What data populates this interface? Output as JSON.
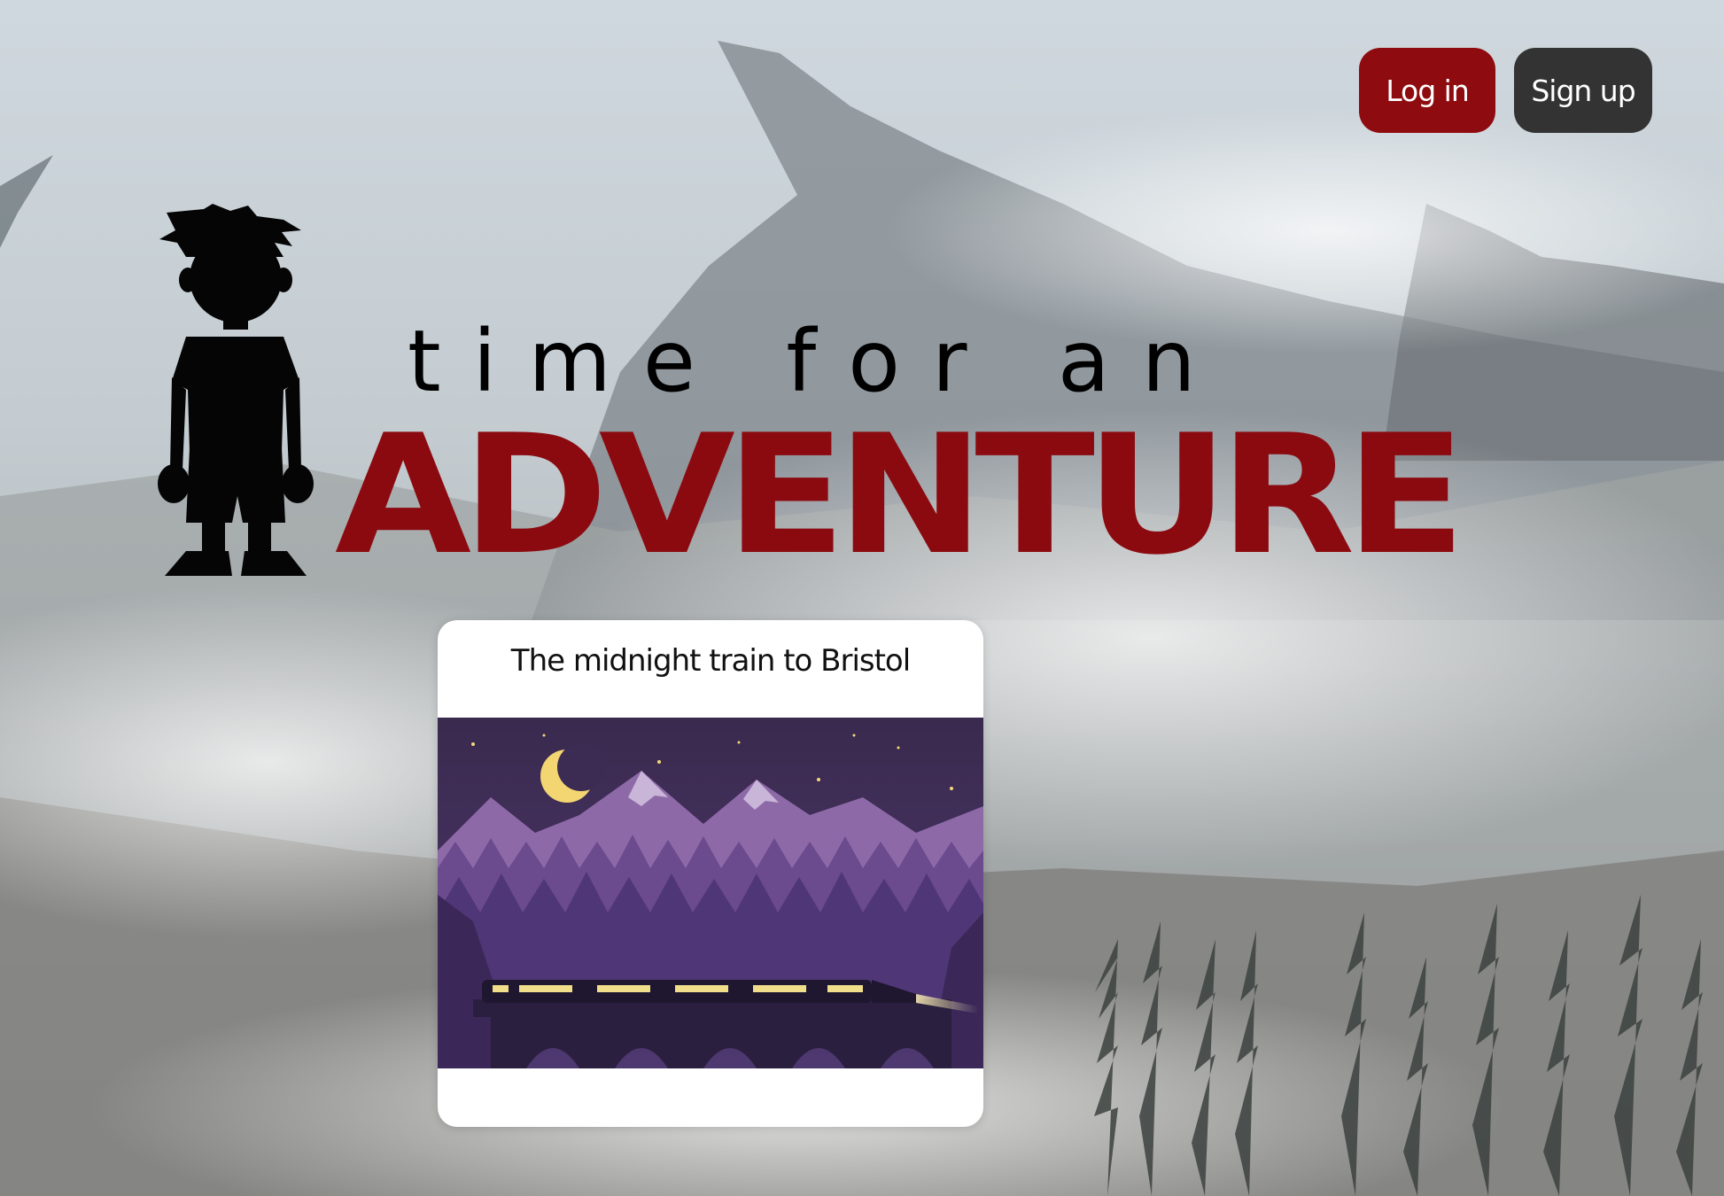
{
  "header": {
    "login_label": "Log in",
    "signup_label": "Sign up"
  },
  "logo": {
    "tagline": "time for an",
    "title": "ADVENTURE",
    "title_color": "#8b0a10"
  },
  "story_card": {
    "title": "The midnight train to Bristol",
    "image_icon": "night-train-illustration"
  },
  "colors": {
    "login_button": "#8e0b0f",
    "signup_button": "#333333"
  }
}
